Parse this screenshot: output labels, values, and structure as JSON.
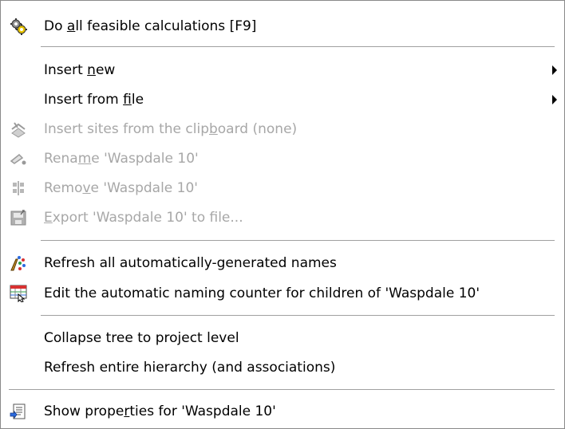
{
  "menu": {
    "items": [
      {
        "pre": "Do ",
        "mn": "a",
        "post": "ll feasible calculations [F9]",
        "icon": "gears-calculate-icon",
        "disabled": false,
        "submenu": false
      },
      {
        "pre": "Insert ",
        "mn": "n",
        "post": "ew",
        "icon": "",
        "disabled": false,
        "submenu": true
      },
      {
        "pre": "Insert from ",
        "mn": "f",
        "post": "ile",
        "icon": "",
        "disabled": false,
        "submenu": true
      },
      {
        "pre": "Insert sites from the clip",
        "mn": "b",
        "post": "oard (none)",
        "icon": "clipboard-sites-icon",
        "disabled": true,
        "submenu": false
      },
      {
        "pre": "Rena",
        "mn": "m",
        "post": "e 'Waspdale 10'",
        "icon": "rename-icon",
        "disabled": true,
        "submenu": false
      },
      {
        "pre": "Remo",
        "mn": "v",
        "post": "e 'Waspdale 10'",
        "icon": "remove-icon",
        "disabled": true,
        "submenu": false
      },
      {
        "pre": "",
        "mn": "E",
        "post": "xport 'Waspdale 10' to file...",
        "icon": "export-icon",
        "disabled": true,
        "submenu": false
      },
      {
        "pre": "Refresh all automatically-generated names",
        "mn": "",
        "post": "",
        "icon": "refresh-names-icon",
        "disabled": false,
        "submenu": false
      },
      {
        "pre": "Edit the automatic naming counter for children of 'Waspdale 10'",
        "mn": "",
        "post": "",
        "icon": "naming-counter-icon",
        "disabled": false,
        "submenu": false
      },
      {
        "pre": "Collapse tree to project level",
        "mn": "",
        "post": "",
        "icon": "",
        "disabled": false,
        "submenu": false
      },
      {
        "pre": "Refresh entire hierarchy (and associations)",
        "mn": "",
        "post": "",
        "icon": "",
        "disabled": false,
        "submenu": false
      },
      {
        "pre": "Show prope",
        "mn": "r",
        "post": "ties for 'Waspdale 10'",
        "icon": "properties-icon",
        "disabled": false,
        "submenu": false
      }
    ]
  }
}
